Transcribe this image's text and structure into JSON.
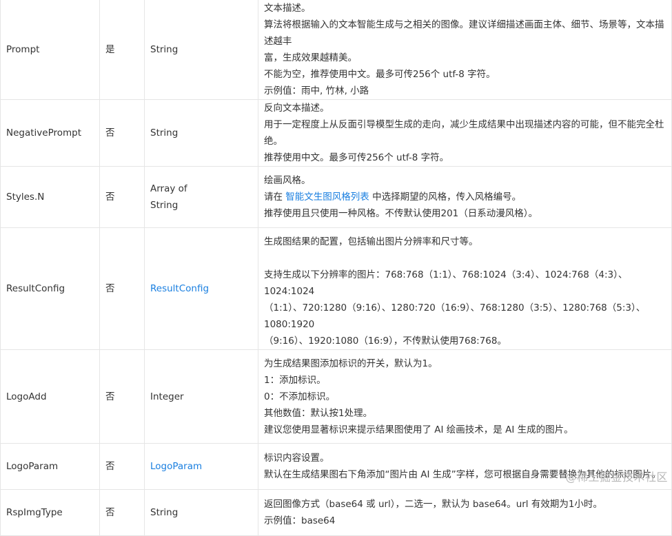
{
  "rows": [
    {
      "name": "Prompt",
      "required": "是",
      "type": "String",
      "desc": [
        "文本描述。",
        "算法将根据输入的文本智能生成与之相关的图像。建议详细描述画面主体、细节、场景等，文本描述越丰",
        "富，生成效果越精美。",
        "不能为空，推荐使用中文。最多可传256个 utf-8 字符。",
        "示例值：雨中, 竹林, 小路"
      ]
    },
    {
      "name": "NegativePrompt",
      "required": "否",
      "type": "String",
      "desc": [
        "反向文本描述。",
        "用于一定程度上从反面引导模型生成的走向，减少生成结果中出现描述内容的可能，但不能完全杜绝。",
        "推荐使用中文。最多可传256个 utf-8 字符。"
      ]
    },
    {
      "name": "Styles.N",
      "required": "否",
      "type_line1": "Array of",
      "type_line2": "String",
      "desc": [
        "绘画风格。",
        "推荐使用且只使用一种风格。不传默认使用201（日系动漫风格）。"
      ],
      "desc_link_prefix": "请在 ",
      "desc_link_text": "智能文生图风格列表",
      "desc_link_suffix": " 中选择期望的风格，传入风格编号。"
    },
    {
      "name": "ResultConfig",
      "required": "否",
      "type": "ResultConfig",
      "desc": [
        "生成图结果的配置，包括输出图片分辨率和尺寸等。",
        "支持生成以下分辨率的图片：768:768（1:1）、768:1024（3:4）、1024:768（4:3）、1024:1024",
        "（1:1）、720:1280（9:16）、1280:720（16:9）、768:1280（3:5）、1280:768（5:3）、1080:1920",
        "（9:16）、1920:1080（16:9），不传默认使用768:768。"
      ]
    },
    {
      "name": "LogoAdd",
      "required": "否",
      "type": "Integer",
      "desc": [
        "为生成结果图添加标识的开关，默认为1。",
        "1：添加标识。",
        "0：不添加标识。",
        "其他数值：默认按1处理。",
        "建议您使用显著标识来提示结果图使用了 AI 绘画技术，是 AI 生成的图片。"
      ]
    },
    {
      "name": "LogoParam",
      "required": "否",
      "type": "LogoParam",
      "desc": [
        "标识内容设置。",
        "默认在生成结果图右下角添加“图片由 AI 生成”字样，您可根据自身需要替换为其他的标识图片。"
      ]
    },
    {
      "name": "RspImgType",
      "required": "否",
      "type": "String",
      "desc": [
        "返回图像方式（base64 或 url），二选一，默认为 base64。url 有效期为1小时。",
        "示例值：base64"
      ]
    }
  ],
  "watermark": "@稀土掘金技术社区",
  "colors": {
    "link": "#1a7fe0",
    "border": "#e5e5e5",
    "text": "#333333"
  }
}
